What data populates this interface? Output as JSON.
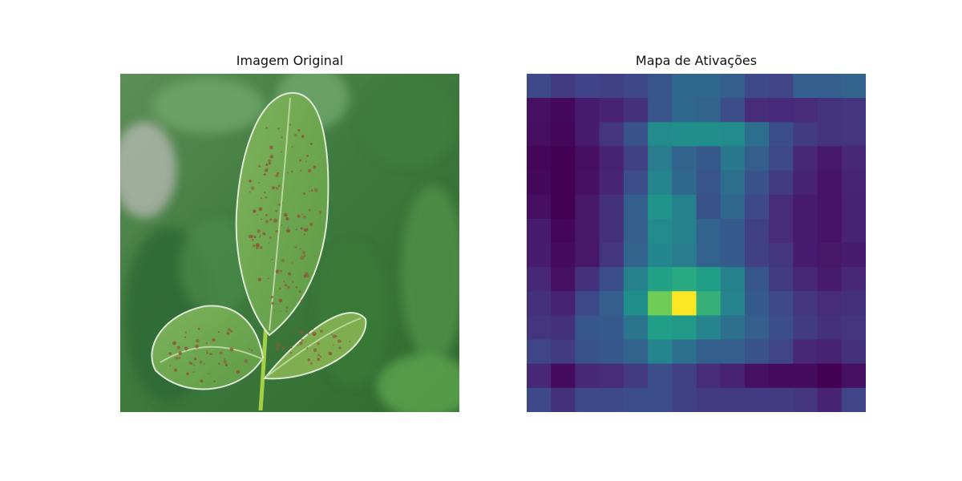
{
  "figure": {
    "left_title": "Imagem Original",
    "right_title": "Mapa de Ativações"
  },
  "chart_data": [
    {
      "type": "image",
      "title": "Imagem Original",
      "subject": "soybean leaf with rust spots",
      "colors": {
        "background_dark": "#2f5e2f",
        "background_mid": "#4f8a46",
        "leaf": "#6fa74f",
        "spots": "#8a5a3a",
        "stem": "#9ccc44"
      }
    },
    {
      "type": "heatmap",
      "title": "Mapa de Ativações",
      "colormap": "viridis",
      "rows": 14,
      "cols": 14,
      "values": [
        [
          0.28,
          0.22,
          0.25,
          0.24,
          0.27,
          0.33,
          0.42,
          0.42,
          0.38,
          0.28,
          0.26,
          0.38,
          0.38,
          0.4
        ],
        [
          0.06,
          0.03,
          0.1,
          0.12,
          0.18,
          0.33,
          0.42,
          0.4,
          0.3,
          0.16,
          0.15,
          0.16,
          0.19,
          0.2
        ],
        [
          0.05,
          0.02,
          0.1,
          0.2,
          0.32,
          0.6,
          0.62,
          0.62,
          0.6,
          0.45,
          0.3,
          0.22,
          0.19,
          0.2
        ],
        [
          0.02,
          0.0,
          0.05,
          0.12,
          0.24,
          0.52,
          0.4,
          0.35,
          0.5,
          0.38,
          0.28,
          0.14,
          0.09,
          0.14
        ],
        [
          0.03,
          0.0,
          0.06,
          0.13,
          0.3,
          0.56,
          0.42,
          0.33,
          0.45,
          0.32,
          0.22,
          0.12,
          0.07,
          0.13
        ],
        [
          0.05,
          0.0,
          0.08,
          0.18,
          0.38,
          0.64,
          0.55,
          0.32,
          0.42,
          0.28,
          0.16,
          0.1,
          0.07,
          0.12
        ],
        [
          0.1,
          0.02,
          0.08,
          0.18,
          0.38,
          0.6,
          0.55,
          0.4,
          0.36,
          0.24,
          0.16,
          0.1,
          0.07,
          0.12
        ],
        [
          0.1,
          0.04,
          0.08,
          0.2,
          0.4,
          0.58,
          0.52,
          0.4,
          0.36,
          0.24,
          0.2,
          0.1,
          0.08,
          0.1
        ],
        [
          0.14,
          0.06,
          0.18,
          0.3,
          0.55,
          0.72,
          0.76,
          0.7,
          0.55,
          0.34,
          0.22,
          0.14,
          0.1,
          0.14
        ],
        [
          0.18,
          0.12,
          0.28,
          0.38,
          0.62,
          0.86,
          1.0,
          0.78,
          0.56,
          0.36,
          0.28,
          0.2,
          0.16,
          0.18
        ],
        [
          0.2,
          0.18,
          0.34,
          0.36,
          0.48,
          0.7,
          0.68,
          0.56,
          0.46,
          0.38,
          0.3,
          0.22,
          0.18,
          0.2
        ],
        [
          0.26,
          0.22,
          0.32,
          0.34,
          0.4,
          0.56,
          0.46,
          0.38,
          0.38,
          0.32,
          0.26,
          0.14,
          0.12,
          0.18
        ],
        [
          0.14,
          0.04,
          0.14,
          0.16,
          0.22,
          0.3,
          0.24,
          0.16,
          0.12,
          0.06,
          0.04,
          0.04,
          0.0,
          0.06
        ],
        [
          0.28,
          0.18,
          0.28,
          0.28,
          0.3,
          0.3,
          0.24,
          0.22,
          0.22,
          0.22,
          0.22,
          0.2,
          0.12,
          0.26
        ]
      ]
    }
  ]
}
